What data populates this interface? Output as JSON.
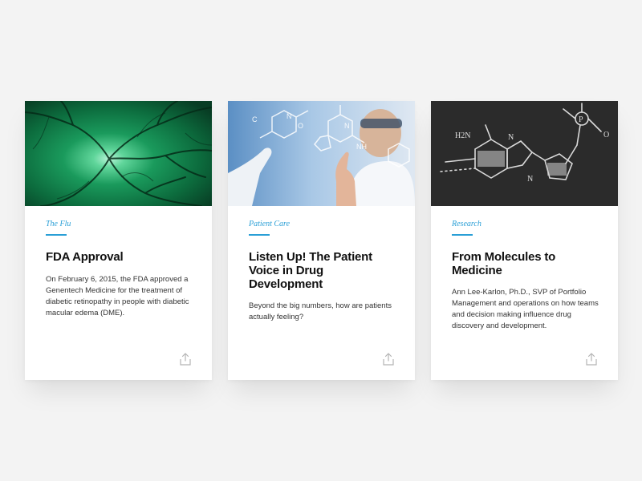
{
  "cards": [
    {
      "category": "The Flu",
      "title": "FDA Approval",
      "description": "On February 6, 2015, the FDA approved a Genentech Medicine for the treatment of diabetic retinopathy in people with diabetic macular edema (DME).",
      "image_subject": "retina-scan"
    },
    {
      "category": "Patient Care",
      "title": "Listen Up! The Patient Voice in Drug Development",
      "description": "Beyond the big numbers, how are patients actually feeling?",
      "image_subject": "scientist-molecule-display"
    },
    {
      "category": "Research",
      "title": "From Molecules to Medicine",
      "description": "Ann Lee-Karlon, Ph.D., SVP of Portfolio Management and operations on how teams and decision making influence drug discovery and development.",
      "image_subject": "chalkboard-molecule"
    }
  ],
  "share_icon": "share-icon",
  "colors": {
    "background": "#f3f3f3",
    "card": "#ffffff",
    "accent": "#2a9fd6",
    "title": "#111111",
    "body": "#333333"
  }
}
